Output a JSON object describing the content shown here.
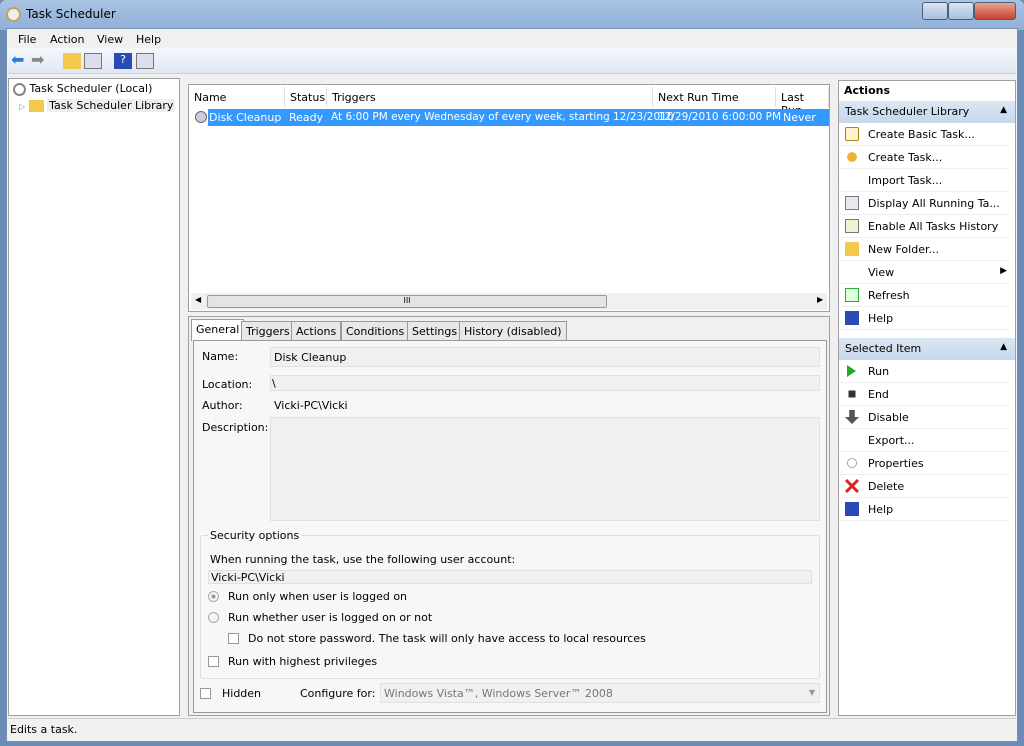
{
  "window": {
    "title": "Task Scheduler"
  },
  "menu": [
    "File",
    "Action",
    "View",
    "Help"
  ],
  "tree": {
    "root": "Task Scheduler (Local)",
    "child": "Task Scheduler Library"
  },
  "list": {
    "columns": [
      "Name",
      "Status",
      "Triggers",
      "Next Run Time",
      "Last Run"
    ],
    "rows": [
      {
        "name": "Disk Cleanup",
        "status": "Ready",
        "triggers": "At 6:00 PM every Wednesday of every week, starting 12/23/2010",
        "next_run": "12/29/2010 6:00:00 PM",
        "last_run": "Never"
      }
    ],
    "scroll_grip": "III"
  },
  "tabs": [
    "General",
    "Triggers",
    "Actions",
    "Conditions",
    "Settings",
    "History (disabled)"
  ],
  "general": {
    "name_label": "Name:",
    "name": "Disk Cleanup",
    "location_label": "Location:",
    "location": "\\",
    "author_label": "Author:",
    "author": "Vicki-PC\\Vicki",
    "description_label": "Description:",
    "description": "",
    "security_title": "Security options",
    "account_prompt": "When running the task, use the following user account:",
    "account": "Vicki-PC\\Vicki",
    "radio_logged_on": "Run only when user is logged on",
    "radio_whether": "Run whether user is logged on or not",
    "no_store_pwd": "Do not store password.  The task will only have access to local resources",
    "highest": "Run with highest privileges",
    "hidden": "Hidden",
    "configure_label": "Configure for:",
    "configure_value": "Windows Vista™, Windows Server™ 2008"
  },
  "actions": {
    "title": "Actions",
    "section1": "Task Scheduler Library",
    "items1": [
      {
        "label": "Create Basic Task...",
        "icon": "wizard-icon"
      },
      {
        "label": "Create Task...",
        "icon": "task-icon"
      },
      {
        "label": "Import Task...",
        "icon": ""
      },
      {
        "label": "Display All Running Ta...",
        "icon": "running-tasks-icon"
      },
      {
        "label": "Enable All Tasks History",
        "icon": "history-icon"
      },
      {
        "label": "New Folder...",
        "icon": "folder-icon"
      },
      {
        "label": "View",
        "icon": ""
      },
      {
        "label": "Refresh",
        "icon": "refresh-icon"
      },
      {
        "label": "Help",
        "icon": "help-icon"
      }
    ],
    "section2": "Selected Item",
    "items2": [
      {
        "label": "Run",
        "icon": "run-icon"
      },
      {
        "label": "End",
        "icon": "stop-icon"
      },
      {
        "label": "Disable",
        "icon": "disable-icon"
      },
      {
        "label": "Export...",
        "icon": ""
      },
      {
        "label": "Properties",
        "icon": "properties-icon"
      },
      {
        "label": "Delete",
        "icon": "delete-icon"
      },
      {
        "label": "Help",
        "icon": "help-icon"
      }
    ]
  },
  "status": "Edits a task.",
  "colors": {
    "selection": "#3399ff",
    "section_header": "#c6d7ec"
  }
}
